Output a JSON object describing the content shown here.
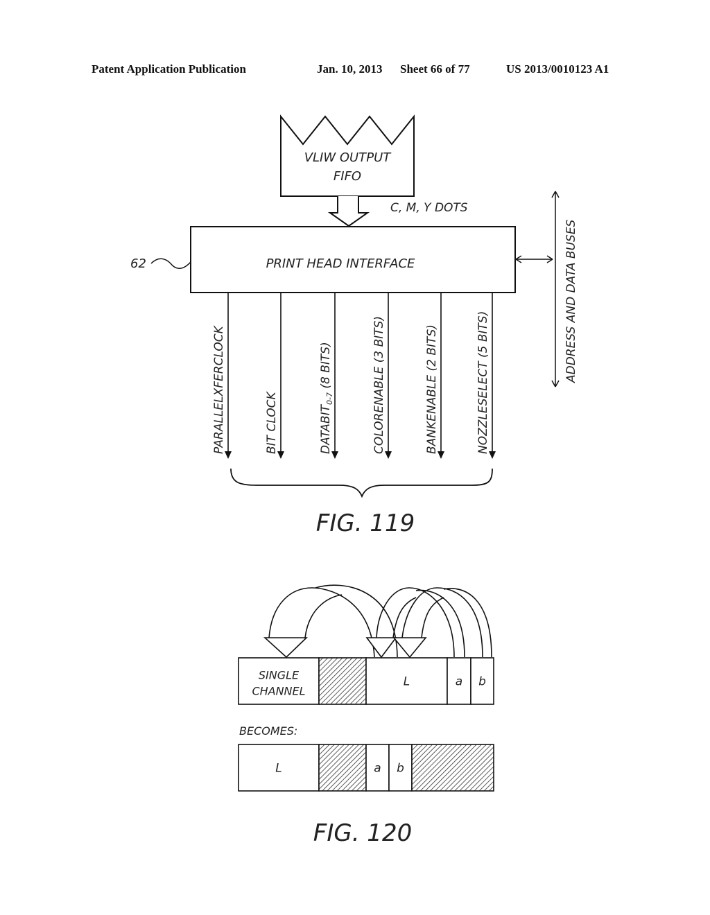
{
  "header": {
    "publication": "Patent Application Publication",
    "date": "Jan. 10, 2013",
    "sheet": "Sheet 66 of 77",
    "patent_number": "US 2013/0010123 A1"
  },
  "fig119": {
    "fifo_label_line1": "VLIW OUTPUT",
    "fifo_label_line2": "FIFO",
    "input_label": "C, M, Y DOTS",
    "interface_label": "PRINT HEAD INTERFACE",
    "reference_numeral": "62",
    "bus_label": "ADDRESS AND DATA BUSES",
    "signals": [
      {
        "name": "PARALLELXFERCLOCK",
        "sub": "",
        "suffix": ""
      },
      {
        "name": "BIT CLOCK",
        "sub": "",
        "suffix": ""
      },
      {
        "name": "DATABIT",
        "sub": "0-7",
        "suffix": " (8 BITS)"
      },
      {
        "name": "COLORENABLE",
        "sub": "",
        "suffix": " (3 BITS)"
      },
      {
        "name": "BANKENABLE",
        "sub": "",
        "suffix": " (2 BITS)"
      },
      {
        "name": "NOZZLESELECT",
        "sub": "",
        "suffix": " (5 BITS)"
      }
    ],
    "caption": "FIG. 119"
  },
  "fig120": {
    "top_row": [
      {
        "label_line1": "SINGLE",
        "label_line2": "CHANNEL",
        "hatched": false
      },
      {
        "label_line1": "",
        "label_line2": "",
        "hatched": true
      },
      {
        "label_line1": "L",
        "label_line2": "",
        "hatched": false
      },
      {
        "label_line1": "a",
        "label_line2": "",
        "hatched": false
      },
      {
        "label_line1": "b",
        "label_line2": "",
        "hatched": false
      }
    ],
    "becomes_label": "BECOMES:",
    "bottom_row": [
      {
        "label": "L",
        "hatched": false
      },
      {
        "label": "",
        "hatched": true
      },
      {
        "label": "a",
        "hatched": false
      },
      {
        "label": "b",
        "hatched": false
      },
      {
        "label": "",
        "hatched": true
      }
    ],
    "caption": "FIG. 120"
  }
}
